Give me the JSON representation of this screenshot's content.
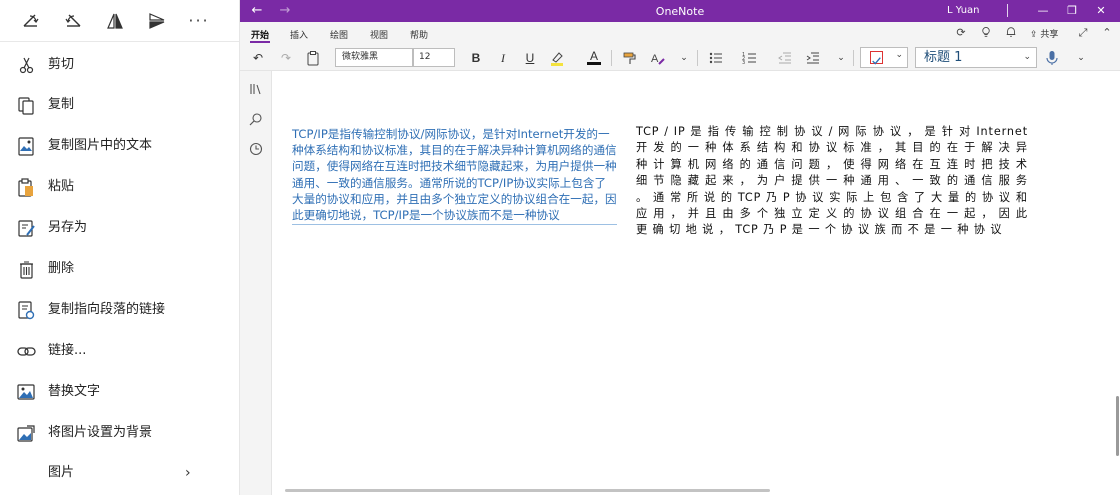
{
  "context_menu": {
    "toolbar": {
      "icons": [
        "rotate-right-icon",
        "rotate-left-icon",
        "flip-horizontal-icon",
        "flip-vertical-icon"
      ],
      "more": "···"
    },
    "items": [
      {
        "label": "剪切",
        "icon": "scissors-icon"
      },
      {
        "label": "复制",
        "icon": "copy-icon"
      },
      {
        "label": "复制图片中的文本",
        "icon": "image-text-icon"
      },
      {
        "label": "粘贴",
        "icon": "paste-icon"
      },
      {
        "label": "另存为",
        "icon": "save-as-icon"
      },
      {
        "label": "删除",
        "icon": "trash-icon"
      },
      {
        "label": "复制指向段落的链接",
        "icon": "link-paragraph-icon"
      },
      {
        "label": "链接...",
        "icon": "link-icon"
      },
      {
        "label": "替换文字",
        "icon": "alt-text-icon"
      },
      {
        "label": "将图片设置为背景",
        "icon": "set-background-icon"
      },
      {
        "label": "图片",
        "icon": "",
        "submenu": "›"
      }
    ]
  },
  "window": {
    "title": "OneNote",
    "user": "L Yuan",
    "controls": [
      "—",
      "❐",
      "✕"
    ],
    "back": "←",
    "forward": "→"
  },
  "ribbon": {
    "tabs": [
      "开始",
      "插入",
      "绘图",
      "视图",
      "帮助"
    ],
    "active_tab": "开始",
    "share_label": "共享",
    "font_name": "微软雅黑",
    "font_size": "12",
    "style_name": "标题 1",
    "bold": "B",
    "italic": "I",
    "underline": "U",
    "font_color": "A"
  },
  "page": {
    "paragraph_left": "TCP/IP是指传输控制协议/网际协议，是针对Internet开发的一种体系结构和协议标准，其目的在于解决异种计算机网络的通信问题，使得网络在互连时把技术细节隐藏起来，为用户提供一种通用、一致的通信服务。通常所说的TCP/IP协议实际上包含了大量的协议和应用，并且由多个独立定义的协议组合在一起，因此更确切地说，TCP/IP是一个协议族而不是一种协议",
    "paragraph_right": "TCP / IP 是 指 传 输 控 制 协 议 / 网 际 协 议 ， 是 针 对 Internet 开 发 的 一 种 体 系 结 构 和 协 议 标 准 ， 其 目 的 在 于 解 决 异 种 计 算 机 网 络 的 通 信 问 题 ， 使 得 网 络 在 互 连 时 把 技 术 细 节 隐 藏 起 来 ， 为 户 提 供 一 种 通 用 、 一 致 的 通 信 服 务 。 通 常 所 说 的 TCP 乃 P 协 议 实 际 上 包 含 了 大 量 的 协 议 和 应 用 ， 并 且 由 多 个 独 立 定 义 的 协 议 组 合 在 一 起 ， 因 此 更 确 切 地 说 ， TCP 乃 P 是 一 个 协 议 族 而 不 是 一 种 协 议"
  },
  "colors": {
    "title_bar": "#7a2aa5",
    "link_text": "#2f6fb5",
    "style_text": "#1f4e79"
  }
}
